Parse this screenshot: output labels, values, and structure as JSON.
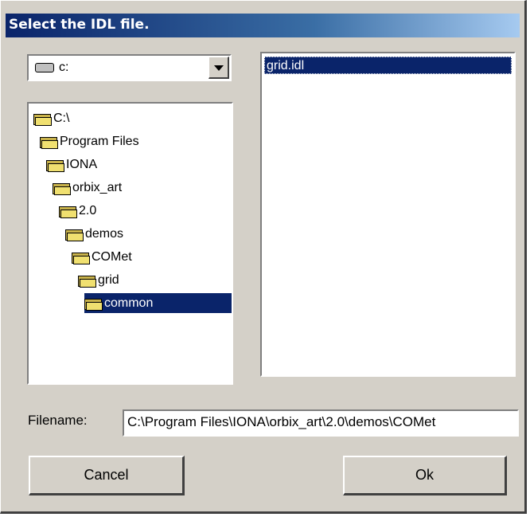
{
  "window": {
    "title": "Select the IDL file."
  },
  "drive_combo": {
    "value": "c:",
    "icon": "drive-icon"
  },
  "directories": [
    {
      "label": "C:\\",
      "indent": 0,
      "selected": false
    },
    {
      "label": "Program Files",
      "indent": 1,
      "selected": false
    },
    {
      "label": "IONA",
      "indent": 2,
      "selected": false
    },
    {
      "label": "orbix_art",
      "indent": 3,
      "selected": false
    },
    {
      "label": "2.0",
      "indent": 4,
      "selected": false
    },
    {
      "label": "demos",
      "indent": 5,
      "selected": false
    },
    {
      "label": "COMet",
      "indent": 6,
      "selected": false
    },
    {
      "label": "grid",
      "indent": 7,
      "selected": false
    },
    {
      "label": "common",
      "indent": 8,
      "selected": true
    }
  ],
  "files": [
    {
      "label": "grid.idl",
      "selected": true
    }
  ],
  "filename": {
    "label": "Filename:",
    "value": "C:\\Program Files\\IONA\\orbix_art\\2.0\\demos\\COMet"
  },
  "buttons": {
    "cancel": "Cancel",
    "ok": "Ok"
  },
  "colors": {
    "selection": "#0a246a",
    "face": "#d4d0c8"
  }
}
